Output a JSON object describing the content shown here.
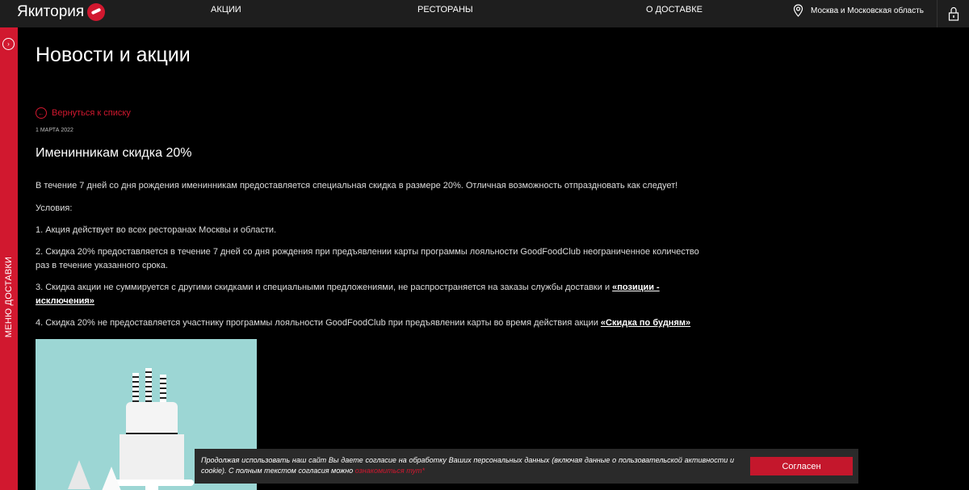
{
  "header": {
    "logo_text": "Якитория",
    "nav": [
      "АКЦИИ",
      "РЕСТОРАНЫ",
      "О ДОСТАВКЕ"
    ],
    "region": "Москва и Московская область",
    "icons": {
      "location": "map-pin-icon",
      "account": "lock-icon"
    }
  },
  "sidebar": {
    "label": "МЕНЮ ДОСТАВКИ",
    "color": "#d1182f"
  },
  "main": {
    "title": "Новости и акции",
    "back_link": "Вернуться к списку",
    "date": "1 МАРТА 2022",
    "article_title": "Именинникам скидка 20%",
    "intro": "В течение 7 дней со дня рождения именинникам предоставляется специальная скидка в размере 20%. Отличная возможность отпраздновать как следует!",
    "conditions_label": " Условия:",
    "cond1": "1. Акция действует во всех ресторанах Москвы и области.",
    "cond2": "2. Скидка  20% предоставляется в течение 7 дней со дня рождения при предъявлении карты программы лояльности GoodFoodClub неограниченное количество раз в течение указанного срока.",
    "cond3_text": "3. Скидка акции не суммируется с другими скидками и специальными предложениями, не распространяется на заказы службы доставки и ",
    "cond3_link": "«позиции - исключения»",
    "cond4_text": "4. Скидка 20% не предоставляется участнику программы лояльности GoodFoodClub при предъявлении карты во время действия акции ",
    "cond4_link": "«Скидка по будням»"
  },
  "cookie": {
    "text": "Продолжая использовать наш сайт Вы даете согласие на обработку Ваших персональных данных (включая данные о пользовательской активности и cookie). С полным текстом согласия можно ",
    "link": "ознакомиться тут",
    "suffix": "*",
    "button": "Согласен"
  },
  "colors": {
    "accent": "#d1182f",
    "background": "#000000",
    "header": "#1e1e1e"
  }
}
